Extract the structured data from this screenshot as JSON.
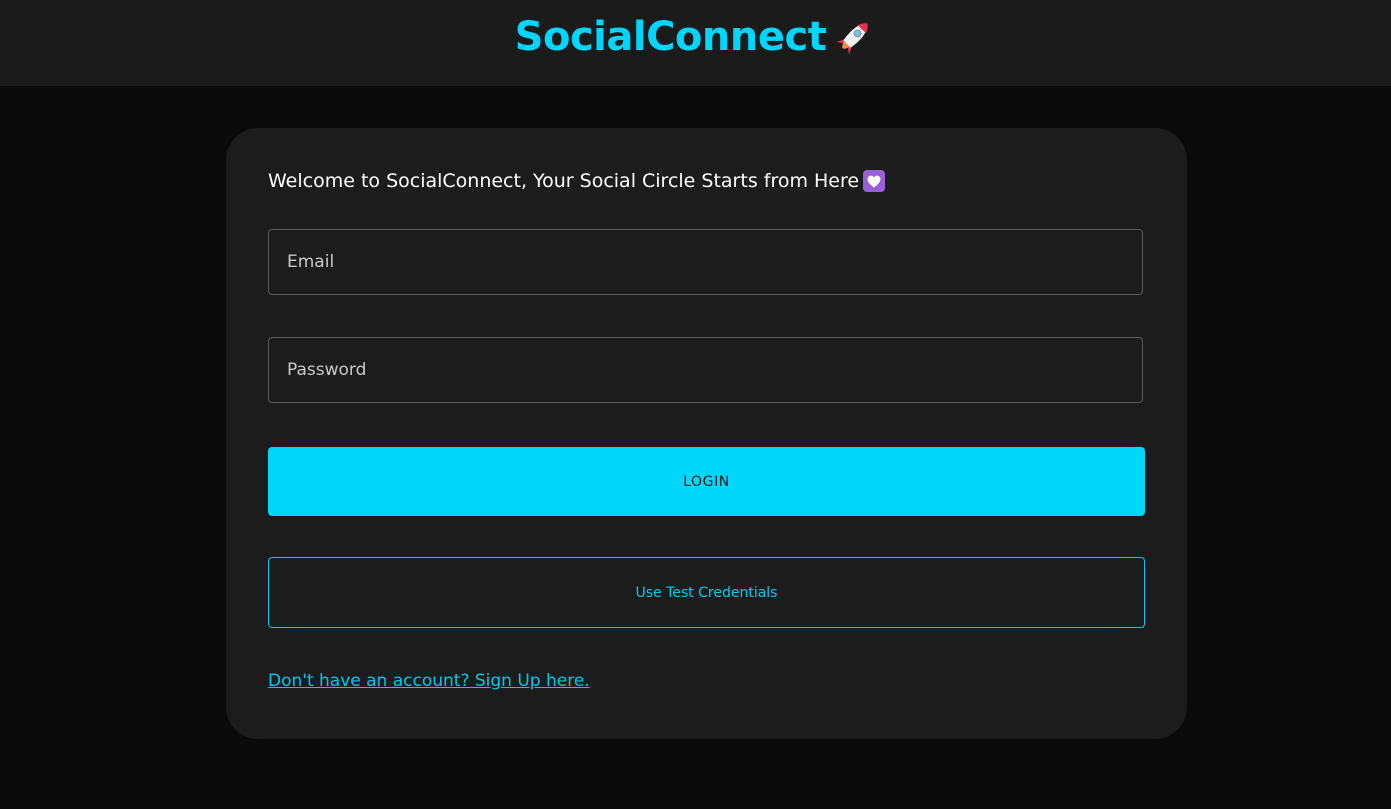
{
  "header": {
    "app_title": "SocialConnect",
    "logo_icon": "rocket-icon"
  },
  "login_card": {
    "welcome_text": "Welcome to SocialConnect, Your Social Circle Starts from Here",
    "welcome_icon": "purple-heart-icon",
    "email": {
      "placeholder": "Email",
      "value": ""
    },
    "password": {
      "placeholder": "Password",
      "value": ""
    },
    "login_label": "LOGIN",
    "test_credentials_label": "Use Test Credentials",
    "signup_link_text": "Don't have an account? Sign Up here."
  },
  "colors": {
    "accent": "#00d7fb",
    "page_background": "#0a0a0a",
    "header_background": "#1b1b1b",
    "card_background": "#1c1c1c"
  }
}
